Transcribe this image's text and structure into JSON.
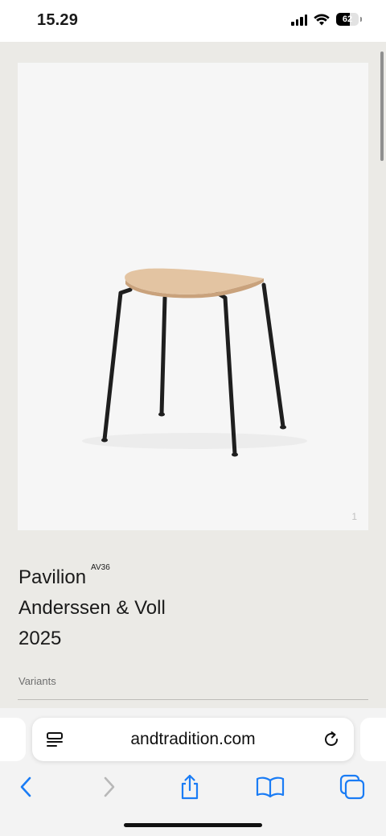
{
  "status_bar": {
    "time": "15.29",
    "battery_percent": "62",
    "battery_level": 0.62,
    "signal_icon": "cellular-signal-icon",
    "wifi_icon": "wifi-icon"
  },
  "product": {
    "name": "Pavilion",
    "code": "AV36",
    "designer": "Anderssen & Voll",
    "year": "2025",
    "image_index": "1",
    "variants_label": "Variants"
  },
  "browser": {
    "url": "andtradition.com",
    "icons": [
      "page-menu-icon",
      "reload-icon",
      "back-icon",
      "forward-icon",
      "share-icon",
      "bookmarks-icon",
      "tabs-icon"
    ],
    "accent_color": "#1a7cf5"
  }
}
